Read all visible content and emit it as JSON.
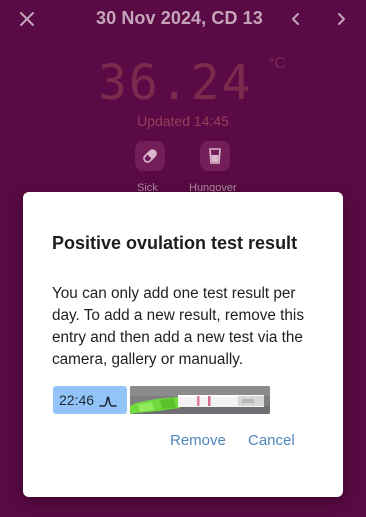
{
  "header": {
    "title": "30 Nov 2024, CD 13"
  },
  "background": {
    "temperature": "36.24",
    "unit": "°C",
    "updated": "Updated 14:45",
    "tags": [
      {
        "label": "Sick",
        "icon": "pill-icon"
      },
      {
        "label": "Hungover",
        "icon": "glass-icon"
      }
    ]
  },
  "dialog": {
    "title": "Positive ovulation test result",
    "body": "You can only add one test result per day. To add a new result, remove this entry and then add a new test via the camera, gallery or manually.",
    "result_time": "22:46",
    "result_icon": "peak-icon",
    "remove_label": "Remove",
    "cancel_label": "Cancel"
  },
  "colors": {
    "backdrop": "#5a0a44",
    "accent_link": "#4f86bd",
    "result_pill": "#92c4f7"
  }
}
